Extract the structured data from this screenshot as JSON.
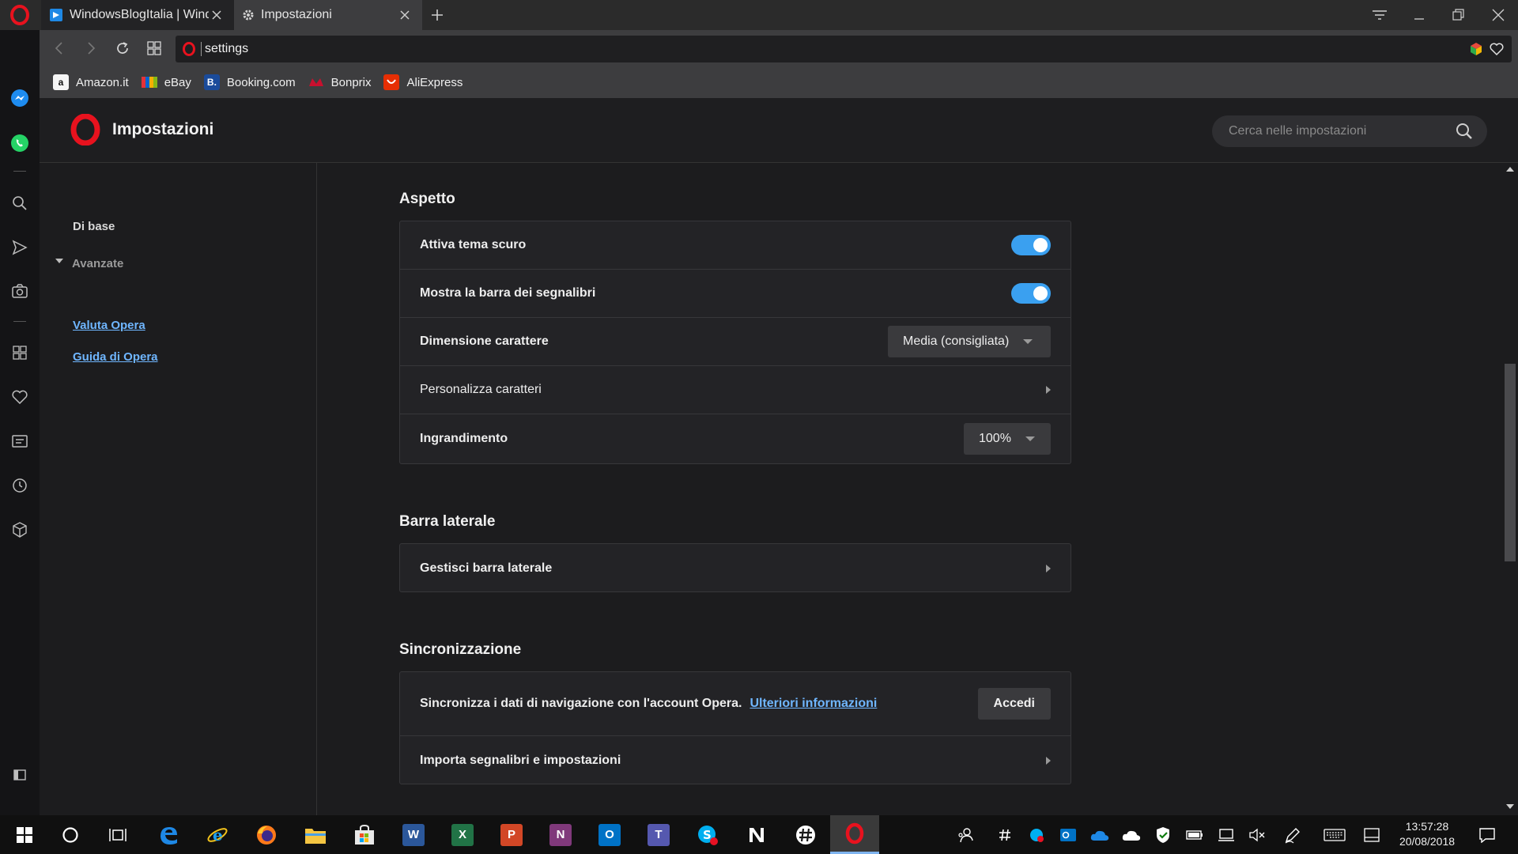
{
  "tabs": [
    {
      "label": "WindowsBlogItalia | Windows",
      "active": false
    },
    {
      "label": "Impostazioni",
      "active": true
    }
  ],
  "address": {
    "value": "settings"
  },
  "bookmarks": [
    {
      "label": "Amazon.it",
      "icon": "amazon-icon",
      "color": "#1f1f1f"
    },
    {
      "label": "eBay",
      "icon": "ebay-icon",
      "color": "#e53238"
    },
    {
      "label": "Booking.com",
      "icon": "booking-icon",
      "color": "#1a4b9b"
    },
    {
      "label": "Bonprix",
      "icon": "bonprix-icon",
      "color": "#c8102e"
    },
    {
      "label": "AliExpress",
      "icon": "aliexpress-icon",
      "color": "#e62e04"
    }
  ],
  "header": {
    "title": "Impostazioni",
    "search_placeholder": "Cerca nelle impostazioni"
  },
  "nav": {
    "basic": "Di base",
    "advanced": "Avanzate",
    "rate": "Valuta Opera",
    "guide": "Guida di Opera"
  },
  "sections": {
    "appearance": {
      "title": "Aspetto",
      "dark_theme": "Attiva tema scuro",
      "dark_theme_on": true,
      "bookmarks_bar": "Mostra la barra dei segnalibri",
      "bookmarks_bar_on": true,
      "font_size": "Dimensione carattere",
      "font_size_value": "Media (consigliata)",
      "custom_fonts": "Personalizza caratteri",
      "zoom": "Ingrandimento",
      "zoom_value": "100%"
    },
    "sidebar": {
      "title": "Barra laterale",
      "manage": "Gestisci barra laterale"
    },
    "sync": {
      "title": "Sincronizzazione",
      "text": "Sincronizza i dati di navigazione con l'account Opera.",
      "more_link": "Ulteriori informazioni",
      "login_button": "Accedi",
      "import": "Importa segnalibri e impostazioni"
    }
  },
  "taskbar": {
    "time": "13:57:28",
    "date": "20/08/2018"
  },
  "colors": {
    "accent": "#3aa0f0",
    "link": "#6fb6ff",
    "opera_red": "#e8121e"
  }
}
